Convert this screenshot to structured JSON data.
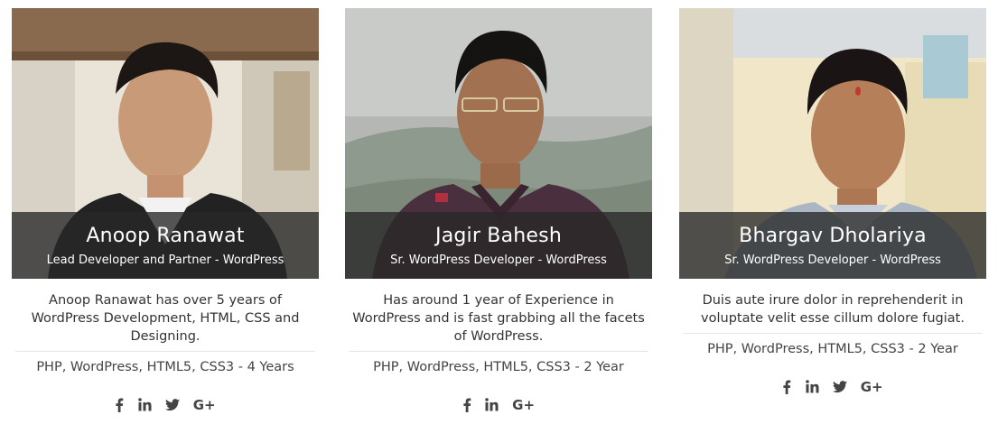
{
  "members": [
    {
      "name": "Anoop Ranawat",
      "role": "Lead Developer and Partner - WordPress",
      "bio": "Anoop Ranawat has over 5 years of WordPress Development, HTML, CSS and Designing.",
      "skills": "PHP, WordPress, HTML5, CSS3 - 4 Years",
      "socials": [
        "facebook-icon",
        "linkedin-icon",
        "twitter-icon",
        "google-plus-icon"
      ],
      "google_plus_label": "G+"
    },
    {
      "name": "Jagir Bahesh",
      "role": "Sr. WordPress Developer - WordPress",
      "bio": "Has around 1 year of Experience in WordPress and is fast grabbing all the facets of WordPress.",
      "skills": "PHP, WordPress, HTML5, CSS3 - 2 Year",
      "socials": [
        "facebook-icon",
        "linkedin-icon",
        "google-plus-icon"
      ],
      "google_plus_label": "G+"
    },
    {
      "name": "Bhargav Dholariya",
      "role": "Sr. WordPress Developer - WordPress",
      "bio": "Duis aute irure dolor in reprehenderit in voluptate velit esse cillum dolore fugiat.",
      "skills": "PHP, WordPress, HTML5, CSS3 - 2 Year",
      "socials": [
        "facebook-icon",
        "linkedin-icon",
        "twitter-icon",
        "google-plus-icon"
      ],
      "google_plus_label": "G+"
    }
  ],
  "colors": {
    "caption_overlay": "#282828",
    "text": "#333333",
    "icon": "#444444"
  }
}
